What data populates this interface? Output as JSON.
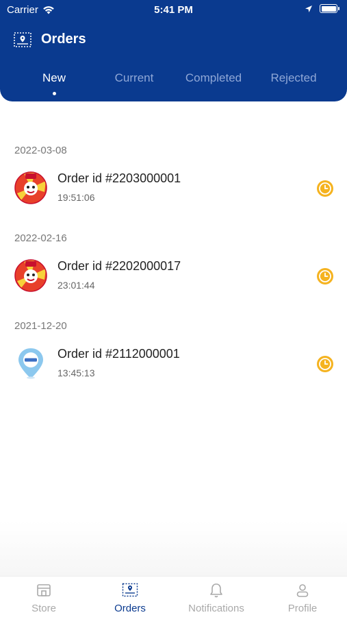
{
  "status_bar": {
    "carrier": "Carrier",
    "time": "5:41 PM"
  },
  "header": {
    "title": "Orders"
  },
  "tabs": [
    {
      "label": "New",
      "active": true
    },
    {
      "label": "Current",
      "active": false
    },
    {
      "label": "Completed",
      "active": false
    },
    {
      "label": "Rejected",
      "active": false
    }
  ],
  "groups": [
    {
      "date": "2022-03-08",
      "order": {
        "id": "Order id #2203000001",
        "time": "19:51:06",
        "avatar": "mascot-logo"
      }
    },
    {
      "date": "2022-02-16",
      "order": {
        "id": "Order id #2202000017",
        "time": "23:01:44",
        "avatar": "mascot-logo"
      }
    },
    {
      "date": "2021-12-20",
      "order": {
        "id": "Order id #2112000001",
        "time": "13:45:13",
        "avatar": "location-pin"
      }
    }
  ],
  "bottom_nav": [
    {
      "label": "Store",
      "icon": "store-icon",
      "active": false
    },
    {
      "label": "Orders",
      "icon": "orders-icon",
      "active": true
    },
    {
      "label": "Notifications",
      "icon": "bell-icon",
      "active": false
    },
    {
      "label": "Profile",
      "icon": "profile-icon",
      "active": false
    }
  ],
  "colors": {
    "primary": "#0a3a8f",
    "pending": "#f5b320",
    "inactive_tab": "#8fa7d6",
    "nav_inactive": "#a9a9a9"
  }
}
